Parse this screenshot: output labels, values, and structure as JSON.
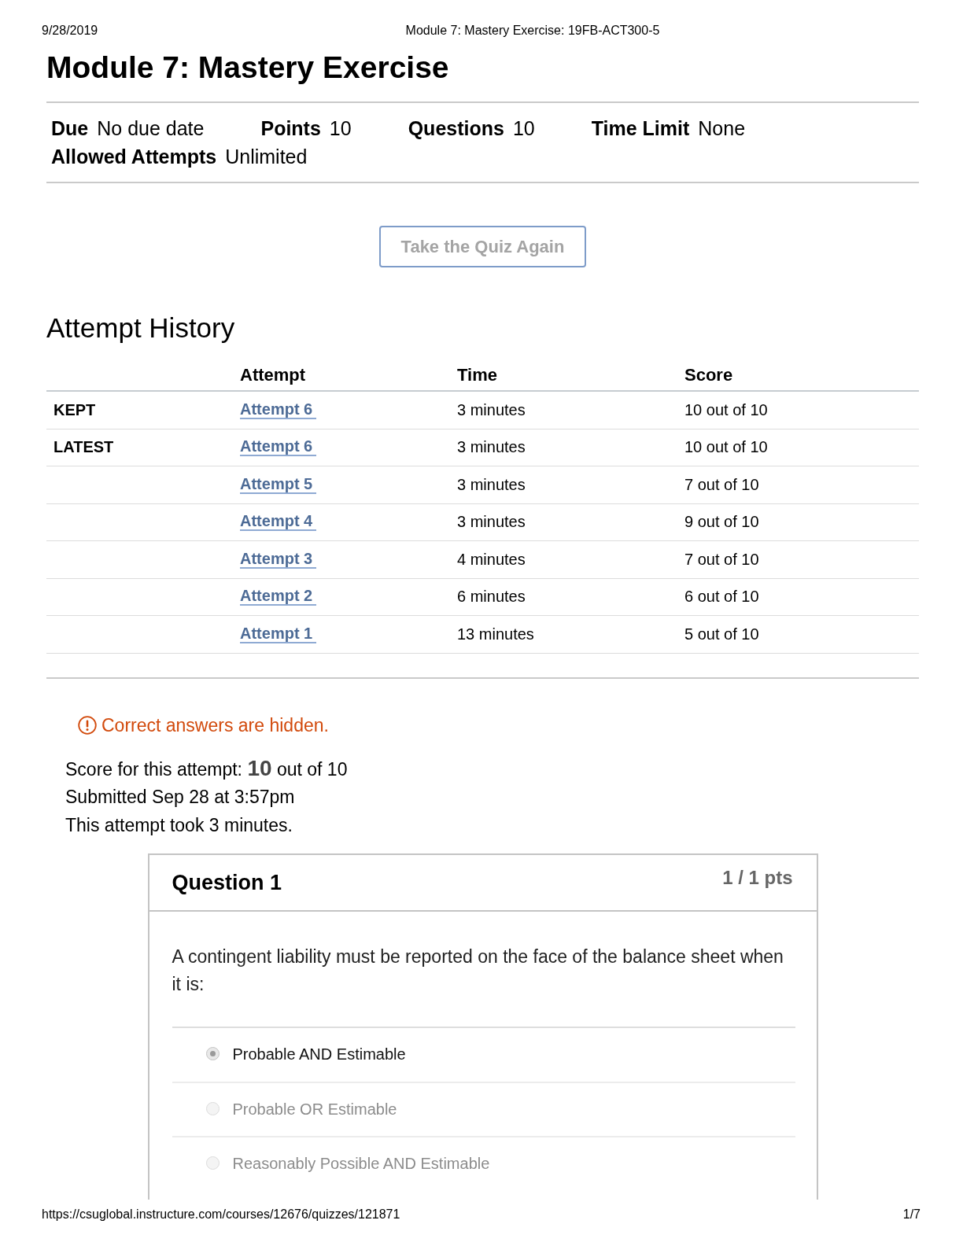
{
  "print_header": {
    "date": "9/28/2019",
    "title": "Module 7: Mastery Exercise: 19FB-ACT300-5"
  },
  "title": "Module 7: Mastery Exercise",
  "details": [
    {
      "label": "Due",
      "value": "No due date"
    },
    {
      "label": "Points",
      "value": "10"
    },
    {
      "label": "Questions",
      "value": "10"
    },
    {
      "label": "Time Limit",
      "value": "None"
    },
    {
      "label": "Allowed Attempts",
      "value": "Unlimited"
    }
  ],
  "retake_button": {
    "label": "Take the Quiz Again"
  },
  "attempt_history": {
    "title": "Attempt History",
    "columns": [
      "Attempt",
      "Time",
      "Score"
    ],
    "rows": [
      {
        "tag": "KEPT",
        "attempt": "Attempt 6",
        "time": "3 minutes",
        "score": "10 out of 10"
      },
      {
        "tag": "LATEST",
        "attempt": "Attempt 6",
        "time": "3 minutes",
        "score": "10 out of 10"
      },
      {
        "attempt": "Attempt 5",
        "time": "3 minutes",
        "score": "7 out of 10"
      },
      {
        "attempt": "Attempt 4",
        "time": "3 minutes",
        "score": "9 out of 10"
      },
      {
        "attempt": "Attempt 3",
        "time": "4 minutes",
        "score": "7 out of 10"
      },
      {
        "attempt": "Attempt 2",
        "time": "6 minutes",
        "score": "6 out of 10"
      },
      {
        "attempt": "Attempt 1",
        "time": "13 minutes",
        "score": "5 out of 10"
      }
    ]
  },
  "notice": {
    "text": "Correct answers are hidden."
  },
  "summary": {
    "score": "Score for this attempt: **10** out of 10",
    "submitted": "Submitted Sep 28 at 3:57pm",
    "duration": "This attempt took 3 minutes."
  },
  "question": {
    "title": "Question 1",
    "points": "1 / 1 pts",
    "text": "A contingent liability must be reported on the face of the balance sheet when it is:",
    "answers": [
      {
        "text": "Probable AND Estimable",
        "selected": true
      },
      {
        "text": "Probable OR Estimable",
        "selected": false
      },
      {
        "text": "Reasonably Possible AND Estimable",
        "selected": false
      }
    ]
  },
  "footer": {
    "url": "https://csuglobal.instructure.com/courses/12676/quizzes/121871",
    "page": "1/7"
  }
}
